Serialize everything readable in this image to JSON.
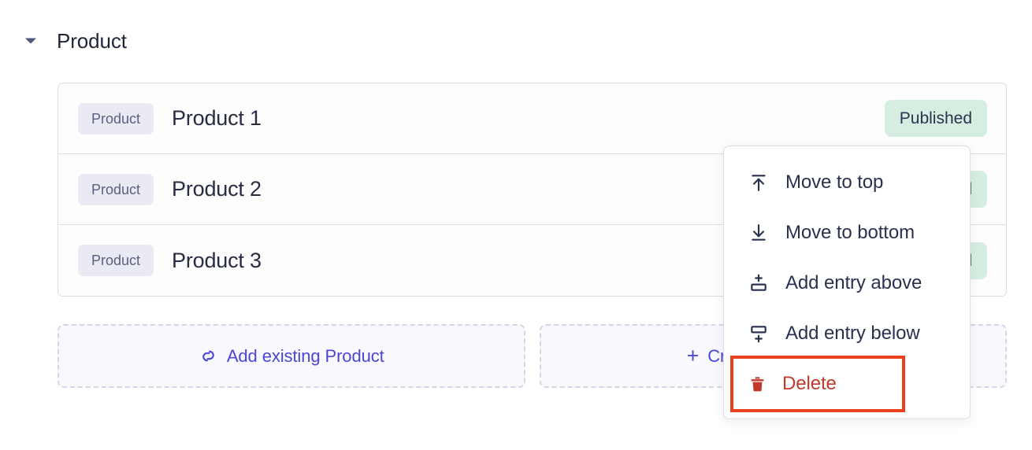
{
  "field": {
    "label": "Product",
    "collapse_icon": "chevron-down-icon",
    "collapsed": false
  },
  "colors": {
    "page_background": "#ffffff",
    "border": "#dcdde6",
    "chip_background": "#e9eaf3",
    "chip_text": "#5a6180",
    "title_text": "#272c42",
    "status_background": "#d6eee1",
    "status_text": "#2a3350",
    "accent_link": "#4b46d6",
    "dashed_border": "#d4d6e6",
    "dashed_background": "#f8f8fd",
    "danger_text": "#c0392b",
    "highlight_outline": "#e8411c"
  },
  "entries": [
    {
      "type_chip": "Product",
      "title": "Product 1",
      "status": "Published"
    },
    {
      "type_chip": "Product",
      "title": "Product 2",
      "status": "Published"
    },
    {
      "type_chip": "Product",
      "title": "Product 3",
      "status": "Published"
    }
  ],
  "actions": [
    {
      "icon": "link-icon",
      "label": "Add existing Product"
    },
    {
      "icon": "plus-icon",
      "label": "Create new Product"
    }
  ],
  "context_menu": {
    "visible": true,
    "items": [
      {
        "icon": "move-to-top-icon",
        "label": "Move to top",
        "danger": false,
        "highlighted": false
      },
      {
        "icon": "move-to-bottom-icon",
        "label": "Move to bottom",
        "danger": false,
        "highlighted": false
      },
      {
        "icon": "add-entry-above-icon",
        "label": "Add entry above",
        "danger": false,
        "highlighted": false
      },
      {
        "icon": "add-entry-below-icon",
        "label": "Add entry below",
        "danger": false,
        "highlighted": false
      },
      {
        "icon": "trash-icon",
        "label": "Delete",
        "danger": true,
        "highlighted": true
      }
    ]
  }
}
